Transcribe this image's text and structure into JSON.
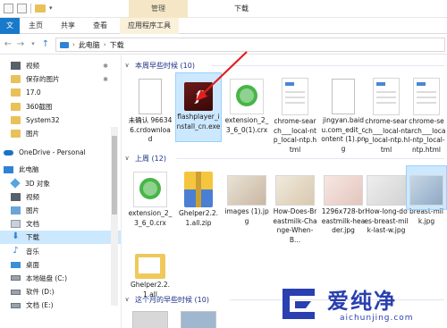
{
  "window": {
    "title": "下载",
    "context_tab_group": "管理"
  },
  "ribbon": {
    "tabs": [
      {
        "label": "文件"
      },
      {
        "label": "主页"
      },
      {
        "label": "共享"
      },
      {
        "label": "查看"
      },
      {
        "label": "应用程序工具"
      }
    ]
  },
  "address": {
    "crumbs": [
      "此电脑",
      "下载"
    ]
  },
  "sidebar": {
    "items": [
      {
        "label": "视频",
        "icon": "video-icon",
        "pinned": true
      },
      {
        "label": "保存的图片",
        "icon": "folder-icon",
        "pinned": true
      },
      {
        "label": "17.0",
        "icon": "folder-icon"
      },
      {
        "label": "360截图",
        "icon": "folder-icon"
      },
      {
        "label": "System32",
        "icon": "folder-icon"
      },
      {
        "label": "图片",
        "icon": "folder-icon"
      },
      {
        "label": "OneDrive - Personal",
        "icon": "onedrive-icon"
      },
      {
        "label": "此电脑",
        "icon": "this-pc-icon"
      },
      {
        "label": "3D 对象",
        "icon": "3d-objects-icon"
      },
      {
        "label": "视频",
        "icon": "video-icon"
      },
      {
        "label": "图片",
        "icon": "pictures-icon"
      },
      {
        "label": "文档",
        "icon": "documents-icon"
      },
      {
        "label": "下载",
        "icon": "download-icon",
        "selected": true
      },
      {
        "label": "音乐",
        "icon": "music-icon"
      },
      {
        "label": "桌面",
        "icon": "desktop-icon"
      },
      {
        "label": "本地磁盘 (C:)",
        "icon": "drive-icon"
      },
      {
        "label": "软件 (D:)",
        "icon": "drive-icon"
      },
      {
        "label": "文档 (E:)",
        "icon": "drive-icon"
      }
    ]
  },
  "groups": [
    {
      "header": "本周早些时候 (10)",
      "files": [
        {
          "name": "未确认 966346.crdownload",
          "thumb": "doc"
        },
        {
          "name": "flashplayer_install_cn.exe",
          "thumb": "flash",
          "selected": true
        },
        {
          "name": "extension_2_3_6_0(1).crx",
          "thumb": "ie"
        },
        {
          "name": "chrome-search___local-ntp_local-ntp.html",
          "thumb": "page"
        },
        {
          "name": "jingyan.baidu.com_edit_content (1).png",
          "thumb": "doc"
        },
        {
          "name": "chrome-search___local-ntp_local-ntp.html",
          "thumb": "page"
        },
        {
          "name": "chrome-search___local-ntp_local-ntp.html",
          "thumb": "page"
        }
      ]
    },
    {
      "header": "上周 (12)",
      "files": [
        {
          "name": "extension_2_3_6_0.crx",
          "thumb": "ie"
        },
        {
          "name": "Ghelper2.2.1.all.zip",
          "thumb": "zip"
        },
        {
          "name": "images (1).jpg",
          "thumb": "photo"
        },
        {
          "name": "How-Does-Breastmilk-Change-When-B...",
          "thumb": "photo2"
        },
        {
          "name": "1296x728-breastmilk-header.jpg",
          "thumb": "photo3"
        },
        {
          "name": "How-long-does-breast-milk-last-w.jpg",
          "thumb": "photo4"
        },
        {
          "name": "breast-milk.jpg",
          "thumb": "photo5",
          "selected": true
        },
        {
          "name": "Ghelper2.2.1.all",
          "thumb": "folder"
        }
      ]
    },
    {
      "header": "这个月的早些时候 (10)",
      "files": []
    }
  ],
  "watermark": {
    "cn": "爱纯净",
    "url": "aichunjing.com"
  }
}
